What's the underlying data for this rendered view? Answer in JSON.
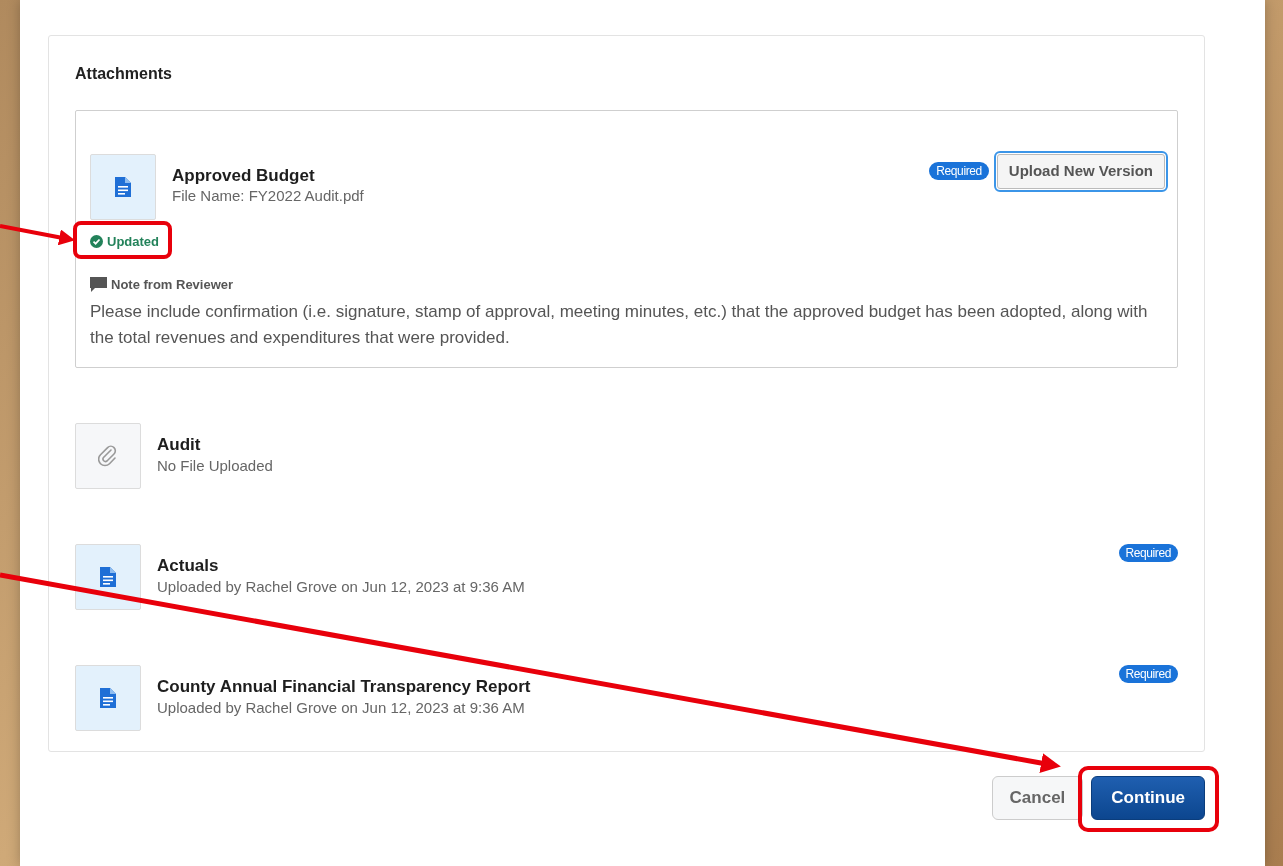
{
  "section": {
    "title": "Attachments"
  },
  "attachments": [
    {
      "kind": "expanded",
      "file_uploaded": true,
      "title": "Approved Budget",
      "subtitle": "File Name: FY2022 Audit.pdf",
      "required": true,
      "required_label": "Required",
      "action": "Upload New Version",
      "status": "Updated",
      "note_title": "Note from Reviewer",
      "note": "Please include confirmation (i.e. signature, stamp of approval, meeting minutes, etc.) that the approved budget has been adopted, along with the total revenues and expenditures that were provided."
    },
    {
      "kind": "plain",
      "file_uploaded": false,
      "title": "Audit",
      "subtitle": "No File Uploaded",
      "required": false
    },
    {
      "kind": "plain",
      "file_uploaded": true,
      "title": "Actuals",
      "subtitle": "Uploaded by Rachel Grove on Jun 12, 2023 at 9:36 AM",
      "required": true,
      "required_label": "Required"
    },
    {
      "kind": "plain",
      "file_uploaded": true,
      "title": "County Annual Financial Transparency Report",
      "subtitle": "Uploaded by Rachel Grove on Jun 12, 2023 at 9:36 AM",
      "required": true,
      "required_label": "Required"
    }
  ],
  "buttons": [
    {
      "label": "Cancel",
      "kind": "secondary"
    },
    {
      "label": "Continue",
      "kind": "primary"
    }
  ]
}
